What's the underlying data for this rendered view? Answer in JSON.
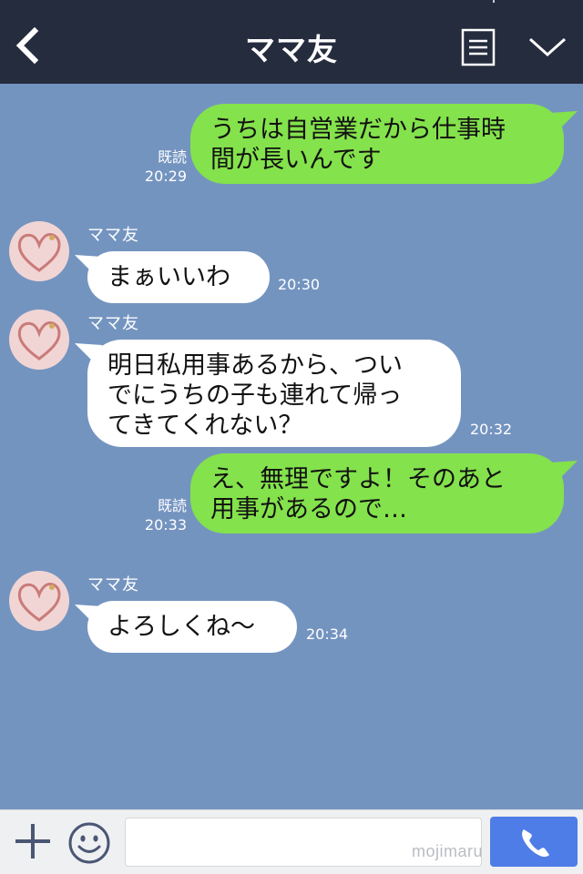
{
  "header": {
    "title": "ママ友",
    "back_icon": "chevron-left-icon",
    "menu_icon": "list-icon",
    "collapse_icon": "chevron-down-icon"
  },
  "messages": [
    {
      "from": "me",
      "text": "うちは自営業だから仕事時\n間が長いんです",
      "read_label": "既読",
      "time": "20:29"
    },
    {
      "from": "ママ友",
      "sender": "ママ友",
      "text": "まぁいいわ",
      "time": "20:30"
    },
    {
      "from": "ママ友",
      "sender": "ママ友",
      "text": "明日私用事あるから、つい\nでにうちの子も連れて帰っ\nてきてくれない？",
      "time": "20:32"
    },
    {
      "from": "me",
      "text": "え、無理ですよ！そのあと\n用事があるので…",
      "read_label": "既読",
      "time": "20:33"
    },
    {
      "from": "ママ友",
      "sender": "ママ友",
      "text": "よろしくね〜",
      "time": "20:34"
    }
  ],
  "input_bar": {
    "plus_icon": "plus-icon",
    "emoji_icon": "smiley-icon",
    "text_value": "",
    "call_icon": "phone-icon",
    "watermark": "mojimaru"
  },
  "colors": {
    "background": "#7494c0",
    "header": "#252c3e",
    "my_bubble": "#84e24c",
    "their_bubble": "#ffffff",
    "call_button": "#4e7de8"
  }
}
